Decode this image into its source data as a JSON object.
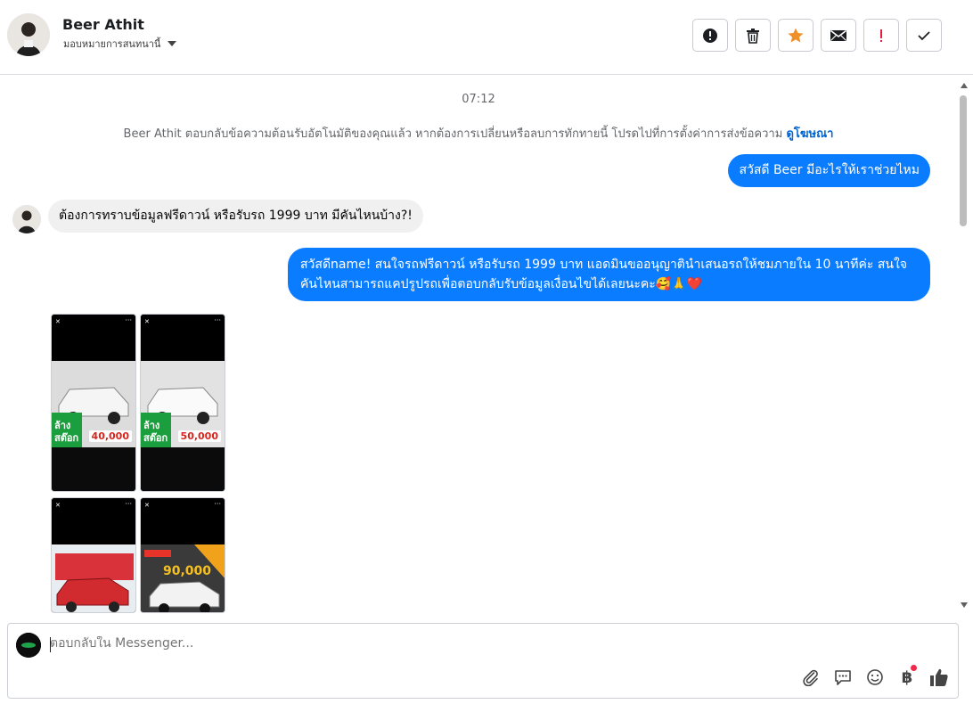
{
  "header": {
    "contact_name": "Beer Athit",
    "assign_label": "มอบหมายการสนทนานี้",
    "toolbar": [
      {
        "name": "spam-button",
        "icon": "alert-circle-icon"
      },
      {
        "name": "delete-button",
        "icon": "trash-icon"
      },
      {
        "name": "star-button",
        "icon": "star-icon"
      },
      {
        "name": "mark-unread-button",
        "icon": "envelope-icon"
      },
      {
        "name": "follow-up-button",
        "icon": "exclamation-icon"
      },
      {
        "name": "done-button",
        "icon": "check-icon"
      }
    ]
  },
  "thread": {
    "time": "07:12",
    "system_note": "Beer Athit ตอบกลับข้อความต้อนรับอัตโนมัติของคุณแล้ว หากต้องการเปลี่ยนหรือลบการทักทายนี้ โปรดไปที่การตั้งค่าการส่งข้อความ",
    "system_link": "ดูโฆษณา",
    "messages": [
      {
        "direction": "out",
        "text": "สวัสดี Beer มีอะไรให้เราช่วยไหม"
      },
      {
        "direction": "in",
        "text": "ต้องการทราบข้อมูลฟรีดาวน์ หรือรับรถ 1999 บาท มีคันไหนบ้าง?!"
      },
      {
        "direction": "out",
        "text": "สวัสดีname! สนใจรถฟรีดาวน์ หรือรับรถ 1999 บาท แอดมินขออนุญาตินำเสนอรถให้ชมภายใน 10 นาทีค่ะ สนใจคันไหนสามารถแคปรูปรถเพื่อตอบกลับรับข้อมูลเงื่อนไขได้เลยนะคะ🥰🙏❤️"
      }
    ],
    "gallery": [
      {
        "price": "40,000"
      },
      {
        "price": "50,000"
      },
      {
        "price": ""
      },
      {
        "price": "90,000"
      }
    ]
  },
  "composer": {
    "placeholder": "ตอบกลับใน Messenger...",
    "tools": [
      "paperclip-icon",
      "saved-replies-icon",
      "emoji-icon",
      "baht-icon",
      "thumbs-up-icon"
    ],
    "baht_symbol": "฿"
  },
  "colors": {
    "accent": "#0a7cff",
    "star": "#f0902b",
    "follow_up": "#e41e3f"
  }
}
